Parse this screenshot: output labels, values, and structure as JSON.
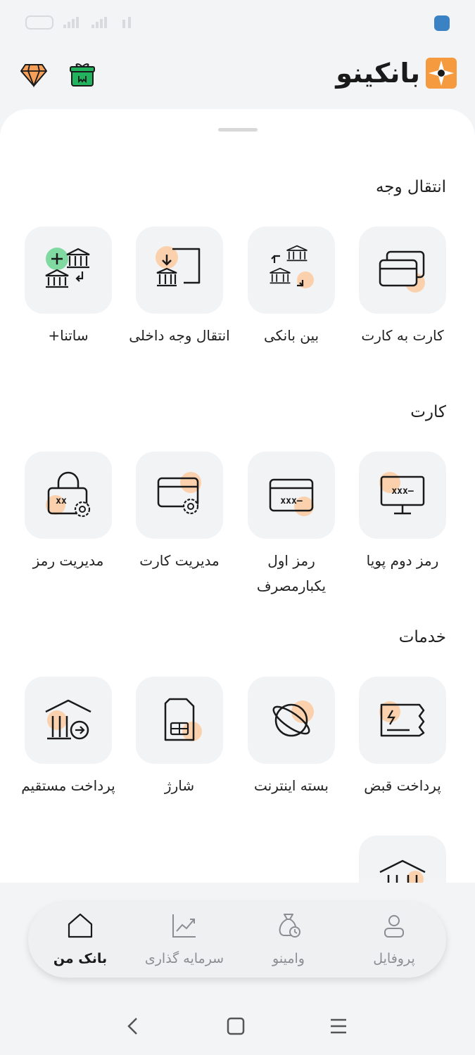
{
  "app": {
    "name": "بانکینو"
  },
  "sections": [
    {
      "title": "انتقال وجه",
      "items": [
        {
          "label": "کارت به کارت",
          "icon": "cards-icon"
        },
        {
          "label": "بین بانکی",
          "icon": "interbank-icon"
        },
        {
          "label": "انتقال وجه داخلی",
          "icon": "internal-transfer-icon"
        },
        {
          "label": "ساتنا+",
          "icon": "satna-icon"
        }
      ]
    },
    {
      "title": "کارت",
      "items": [
        {
          "label": "رمز دوم پویا",
          "icon": "dynamic-password-icon"
        },
        {
          "label": "رمز اول یکبارمصرف",
          "icon": "otp-card-icon"
        },
        {
          "label": "مدیریت کارت",
          "icon": "card-settings-icon"
        },
        {
          "label": "مدیریت رمز",
          "icon": "password-settings-icon"
        }
      ]
    },
    {
      "title": "خدمات",
      "items": [
        {
          "label": "پرداخت قبض",
          "icon": "bill-icon"
        },
        {
          "label": "بسته اینترنت",
          "icon": "internet-icon"
        },
        {
          "label": "شارژ",
          "icon": "sim-icon"
        },
        {
          "label": "پرداخت مستقیم",
          "icon": "direct-pay-icon"
        }
      ]
    }
  ],
  "nav": [
    {
      "label": "پروفایل",
      "icon": "user-icon"
    },
    {
      "label": "وامینو",
      "icon": "loan-bag-icon"
    },
    {
      "label": "سرمایه گذاری",
      "icon": "chart-icon"
    },
    {
      "label": "بانک من",
      "icon": "home-icon"
    }
  ],
  "colors": {
    "accent": "#f5a05a",
    "accent_light": "#fbd1ad",
    "gift": "#22b35e",
    "tile_bg": "#f2f3f5"
  }
}
